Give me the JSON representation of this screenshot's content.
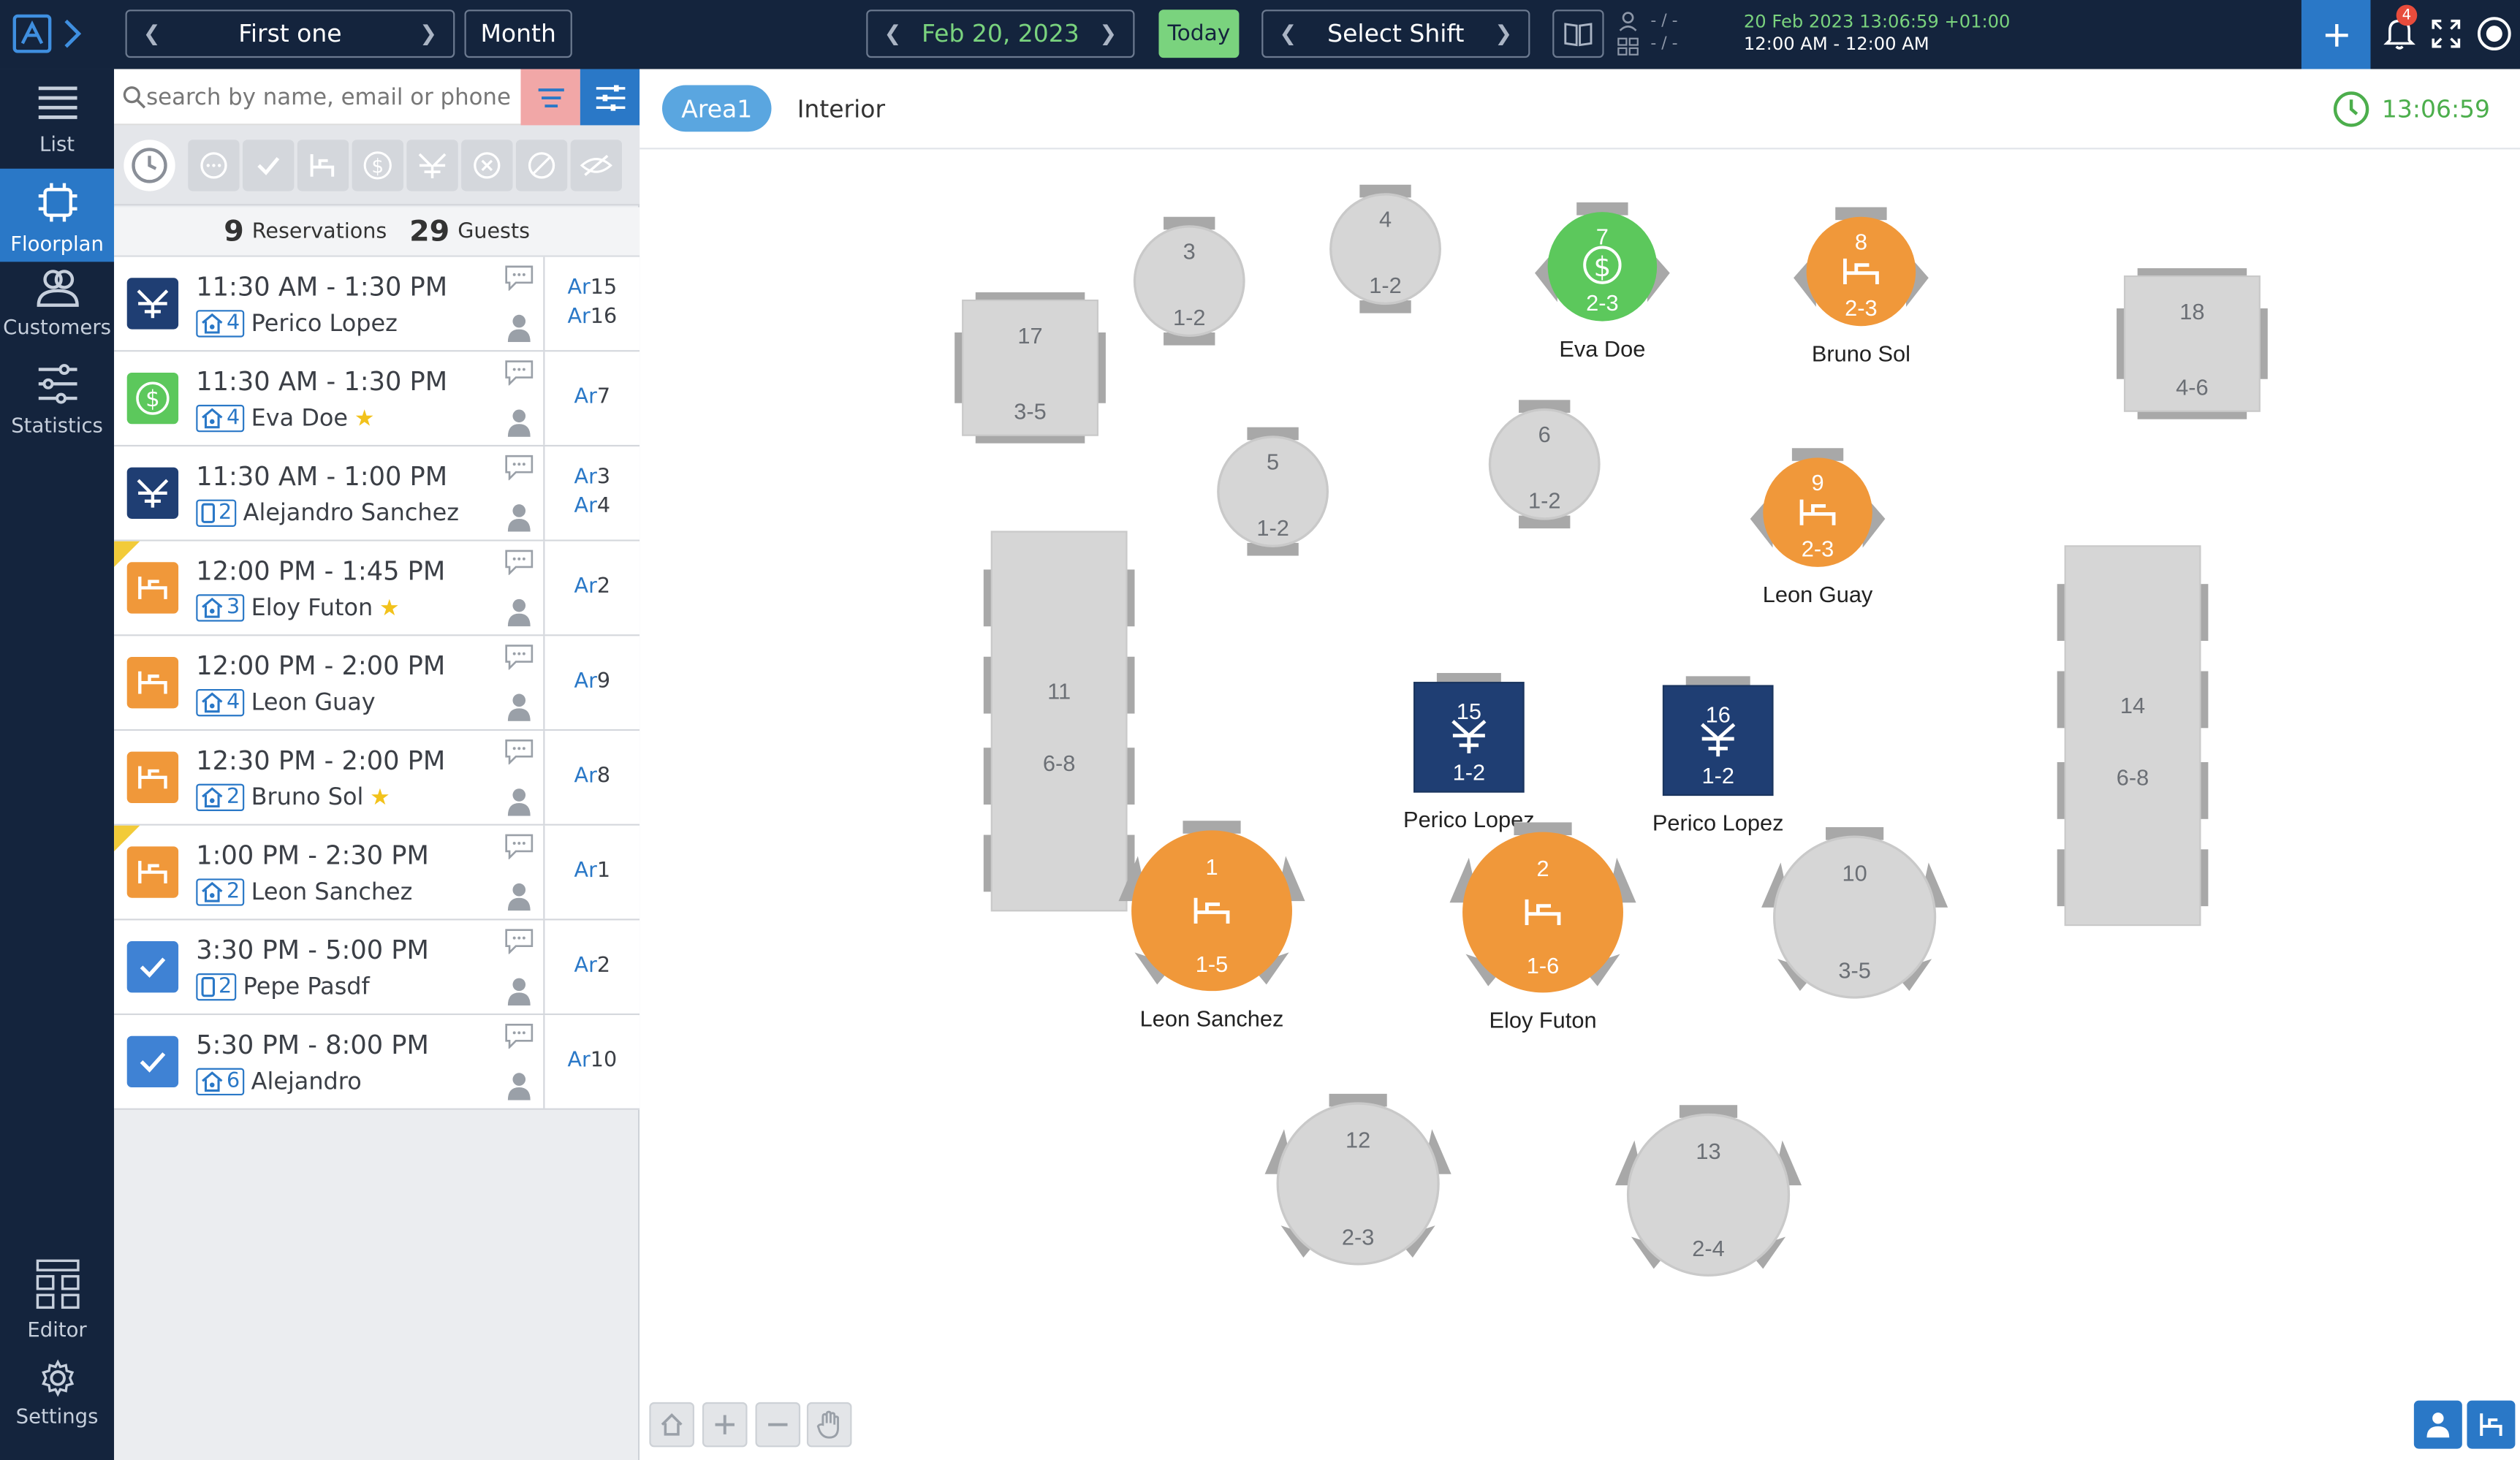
{
  "topbar": {
    "prev_label": "<",
    "period_name": "First one",
    "period_mode": "Month",
    "date": "Feb 20, 2023",
    "today": "Today",
    "shift": "Select Shift",
    "counter_top": "- / -",
    "counter_bottom": "- / -",
    "datetime": "20 Feb 2023 13:06:59 +01:00",
    "time_range": "12:00 AM - 12:00 AM",
    "notifications": "4",
    "colors": {
      "bg": "#14243d",
      "today": "#7ad37e",
      "add": "#2a78c7"
    }
  },
  "sidebar": {
    "items": [
      {
        "label": "List",
        "icon": "list-icon"
      },
      {
        "label": "Floorplan",
        "icon": "floorplan-icon"
      },
      {
        "label": "Customers",
        "icon": "customers-icon"
      },
      {
        "label": "Statistics",
        "icon": "statistics-icon"
      }
    ],
    "bottom": [
      {
        "label": "Editor",
        "icon": "editor-icon"
      },
      {
        "label": "Settings",
        "icon": "gear-icon"
      }
    ]
  },
  "search": {
    "placeholder": "search by name, email or phone"
  },
  "summary": {
    "reservations_count": "9",
    "reservations_label": "Reservations",
    "guests_count": "29",
    "guests_label": "Guests"
  },
  "reservations": [
    {
      "time": "11:30 AM - 1:30 PM",
      "party": "4",
      "name": "Perico Lopez",
      "star": false,
      "status": "seated",
      "source": "house",
      "tables": [
        "15",
        "16"
      ],
      "flag": false
    },
    {
      "time": "11:30 AM - 1:30 PM",
      "party": "4",
      "name": "Eva Doe",
      "star": true,
      "status": "paid",
      "source": "house",
      "tables": [
        "7"
      ],
      "flag": false
    },
    {
      "time": "11:30 AM - 1:00 PM",
      "party": "2",
      "name": "Alejandro Sanchez",
      "star": false,
      "status": "seated",
      "source": "phone",
      "tables": [
        "3",
        "4"
      ],
      "flag": false
    },
    {
      "time": "12:00 PM - 1:45 PM",
      "party": "3",
      "name": "Eloy Futon",
      "star": true,
      "status": "arrived",
      "source": "house",
      "tables": [
        "2"
      ],
      "flag": true
    },
    {
      "time": "12:00 PM - 2:00 PM",
      "party": "4",
      "name": "Leon Guay",
      "star": false,
      "status": "arrived",
      "source": "house",
      "tables": [
        "9"
      ],
      "flag": false
    },
    {
      "time": "12:30 PM - 2:00 PM",
      "party": "2",
      "name": "Bruno Sol",
      "star": true,
      "status": "arrived",
      "source": "house",
      "tables": [
        "8"
      ],
      "flag": false
    },
    {
      "time": "1:00 PM - 2:30 PM",
      "party": "2",
      "name": "Leon Sanchez",
      "star": false,
      "status": "arrived",
      "source": "house",
      "tables": [
        "1"
      ],
      "flag": true
    },
    {
      "time": "3:30 PM - 5:00 PM",
      "party": "2",
      "name": "Pepe Pasdf",
      "star": false,
      "status": "confirmed",
      "source": "phone",
      "tables": [
        "2"
      ],
      "flag": false
    },
    {
      "time": "5:30 PM - 8:00 PM",
      "party": "6",
      "name": "Alejandro",
      "star": false,
      "status": "confirmed",
      "source": "house",
      "tables": [
        "10"
      ],
      "flag": false
    }
  ],
  "table_prefix": "Ar",
  "status_colors": {
    "seated": "#1f3e73",
    "paid": "#5cc85c",
    "arrived": "#f0983a",
    "confirmed": "#3f82d4",
    "free": "#d6d6d6"
  },
  "area": {
    "active": "Area1",
    "other": "Interior",
    "clock": "13:06:59"
  },
  "floor_tables": [
    {
      "id": "17",
      "capacity": "3-5",
      "shape": "rect",
      "status": "free",
      "guest": ""
    },
    {
      "id": "3",
      "capacity": "1-2",
      "shape": "round",
      "status": "free",
      "guest": ""
    },
    {
      "id": "4",
      "capacity": "1-2",
      "shape": "round",
      "status": "free",
      "guest": ""
    },
    {
      "id": "7",
      "capacity": "2-3",
      "shape": "round",
      "status": "paid",
      "guest": "Eva Doe"
    },
    {
      "id": "8",
      "capacity": "2-3",
      "shape": "round",
      "status": "arrived",
      "guest": "Bruno Sol"
    },
    {
      "id": "18",
      "capacity": "4-6",
      "shape": "rect",
      "status": "free",
      "guest": ""
    },
    {
      "id": "11",
      "capacity": "6-8",
      "shape": "long",
      "status": "free",
      "guest": ""
    },
    {
      "id": "5",
      "capacity": "1-2",
      "shape": "round",
      "status": "free",
      "guest": ""
    },
    {
      "id": "6",
      "capacity": "1-2",
      "shape": "round",
      "status": "free",
      "guest": ""
    },
    {
      "id": "9",
      "capacity": "2-3",
      "shape": "round",
      "status": "arrived",
      "guest": "Leon Guay"
    },
    {
      "id": "14",
      "capacity": "6-8",
      "shape": "long",
      "status": "free",
      "guest": ""
    },
    {
      "id": "15",
      "capacity": "1-2",
      "shape": "square",
      "status": "seated",
      "guest": "Perico Lopez"
    },
    {
      "id": "16",
      "capacity": "1-2",
      "shape": "square",
      "status": "seated",
      "guest": "Perico Lopez"
    },
    {
      "id": "1",
      "capacity": "1-5",
      "shape": "biground",
      "status": "arrived",
      "guest": "Leon Sanchez"
    },
    {
      "id": "2",
      "capacity": "1-6",
      "shape": "biground",
      "status": "arrived",
      "guest": "Eloy Futon"
    },
    {
      "id": "10",
      "capacity": "3-5",
      "shape": "biground",
      "status": "free",
      "guest": ""
    },
    {
      "id": "12",
      "capacity": "2-3",
      "shape": "biground",
      "status": "free",
      "guest": ""
    },
    {
      "id": "13",
      "capacity": "2-4",
      "shape": "biground",
      "status": "free",
      "guest": ""
    }
  ]
}
